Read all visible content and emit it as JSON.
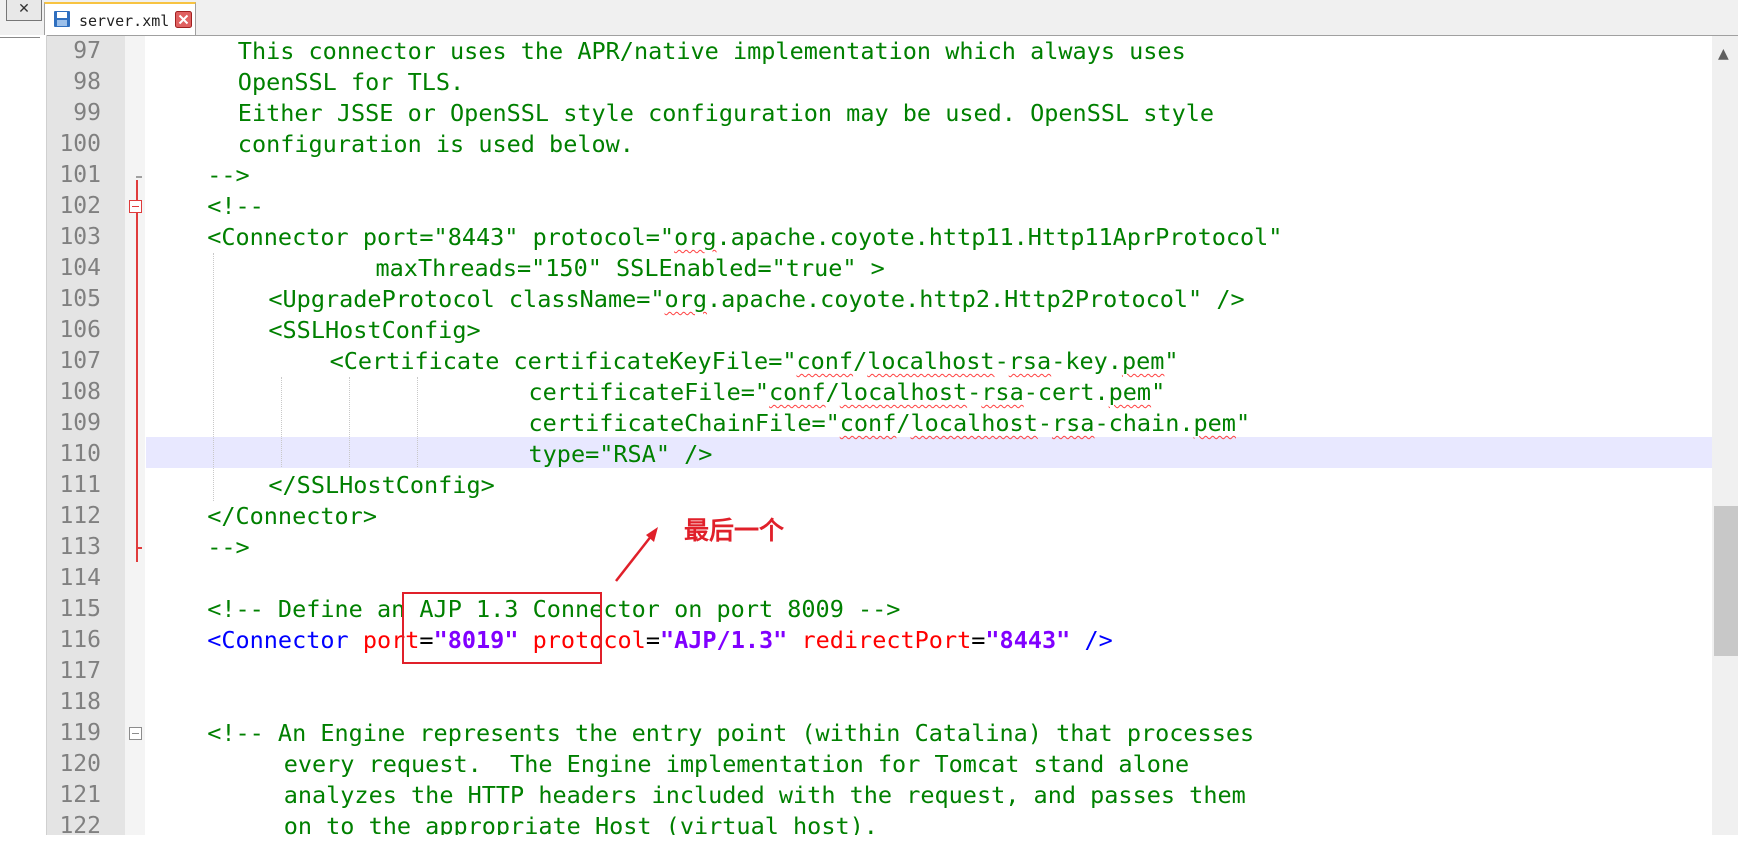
{
  "tab": {
    "close_all_glyph": "✕",
    "filename": "server.xml"
  },
  "annotation": {
    "label": "最后一个",
    "color": "#e0202a"
  },
  "editor": {
    "current_line": 110,
    "lines": [
      {
        "n": "97",
        "indent": 6,
        "segs": [
          {
            "c": "cm",
            "t": "This connector uses the APR/native implementation which always uses"
          }
        ]
      },
      {
        "n": "98",
        "indent": 6,
        "segs": [
          {
            "c": "cm",
            "t": "OpenSSL for TLS."
          }
        ]
      },
      {
        "n": "99",
        "indent": 6,
        "segs": [
          {
            "c": "cm",
            "t": "Either JSSE or OpenSSL style configuration may be used. OpenSSL style"
          }
        ]
      },
      {
        "n": "100",
        "indent": 6,
        "segs": [
          {
            "c": "cm",
            "t": "configuration is used below."
          }
        ]
      },
      {
        "n": "101",
        "indent": 4,
        "segs": [
          {
            "c": "cm",
            "t": "-->"
          }
        ]
      },
      {
        "n": "102",
        "indent": 4,
        "segs": [
          {
            "c": "cm",
            "t": "<!--"
          }
        ]
      },
      {
        "n": "103",
        "indent": 4,
        "segs": [
          {
            "c": "cm",
            "t": "<Connector port=\"8443\" protocol=\""
          },
          {
            "c": "cm sq",
            "t": "org"
          },
          {
            "c": "cm",
            "t": ".apache.coyote.http11.Http11AprProtocol\""
          }
        ]
      },
      {
        "n": "104",
        "indent": 15,
        "segs": [
          {
            "c": "cm",
            "t": "maxThreads=\"150\" SSLEnabled=\"true\" >"
          }
        ]
      },
      {
        "n": "105",
        "indent": 8,
        "segs": [
          {
            "c": "cm",
            "t": "<UpgradeProtocol className=\""
          },
          {
            "c": "cm sq",
            "t": "org"
          },
          {
            "c": "cm",
            "t": ".apache.coyote.http2.Http2Protocol\" />"
          }
        ]
      },
      {
        "n": "106",
        "indent": 8,
        "segs": [
          {
            "c": "cm",
            "t": "<SSLHostConfig>"
          }
        ]
      },
      {
        "n": "107",
        "indent": 12,
        "segs": [
          {
            "c": "cm",
            "t": "<Certificate certificateKeyFile=\""
          },
          {
            "c": "cm sq",
            "t": "conf"
          },
          {
            "c": "cm",
            "t": "/"
          },
          {
            "c": "cm sq",
            "t": "localhost"
          },
          {
            "c": "cm",
            "t": "-"
          },
          {
            "c": "cm sq",
            "t": "rsa"
          },
          {
            "c": "cm",
            "t": "-key."
          },
          {
            "c": "cm sq",
            "t": "pem"
          },
          {
            "c": "cm",
            "t": "\""
          }
        ]
      },
      {
        "n": "108",
        "indent": 25,
        "segs": [
          {
            "c": "cm",
            "t": "certificateFile=\""
          },
          {
            "c": "cm sq",
            "t": "conf"
          },
          {
            "c": "cm",
            "t": "/"
          },
          {
            "c": "cm sq",
            "t": "localhost"
          },
          {
            "c": "cm",
            "t": "-"
          },
          {
            "c": "cm sq",
            "t": "rsa"
          },
          {
            "c": "cm",
            "t": "-cert."
          },
          {
            "c": "cm sq",
            "t": "pem"
          },
          {
            "c": "cm",
            "t": "\""
          }
        ]
      },
      {
        "n": "109",
        "indent": 25,
        "segs": [
          {
            "c": "cm",
            "t": "certificateChainFile=\""
          },
          {
            "c": "cm sq",
            "t": "conf"
          },
          {
            "c": "cm",
            "t": "/"
          },
          {
            "c": "cm sq",
            "t": "localhost"
          },
          {
            "c": "cm",
            "t": "-"
          },
          {
            "c": "cm sq",
            "t": "rsa"
          },
          {
            "c": "cm",
            "t": "-chain."
          },
          {
            "c": "cm sq",
            "t": "pem"
          },
          {
            "c": "cm",
            "t": "\""
          }
        ]
      },
      {
        "n": "110",
        "indent": 25,
        "segs": [
          {
            "c": "cm",
            "t": "type=\"RSA\" />"
          }
        ]
      },
      {
        "n": "111",
        "indent": 8,
        "segs": [
          {
            "c": "cm",
            "t": "</SSLHostConfig>"
          }
        ]
      },
      {
        "n": "112",
        "indent": 4,
        "segs": [
          {
            "c": "cm",
            "t": "</Connector>"
          }
        ]
      },
      {
        "n": "113",
        "indent": 4,
        "segs": [
          {
            "c": "cm",
            "t": "-->"
          }
        ]
      },
      {
        "n": "114",
        "indent": 0,
        "segs": []
      },
      {
        "n": "115",
        "indent": 4,
        "segs": [
          {
            "c": "cm",
            "t": "<!-- Define an AJP 1.3 Connector on port 8009 -->"
          }
        ]
      },
      {
        "n": "116",
        "indent": 4,
        "segs": [
          {
            "c": "tg",
            "t": "<Connector "
          },
          {
            "c": "at",
            "t": "port"
          },
          {
            "c": "pl",
            "t": "="
          },
          {
            "c": "vl",
            "t": "\"8019\""
          },
          {
            "c": "pl",
            "t": " "
          },
          {
            "c": "at",
            "t": "protocol"
          },
          {
            "c": "pl",
            "t": "="
          },
          {
            "c": "vl",
            "t": "\"AJP/1.3\""
          },
          {
            "c": "pl",
            "t": " "
          },
          {
            "c": "at",
            "t": "redirectPort"
          },
          {
            "c": "pl",
            "t": "="
          },
          {
            "c": "vl",
            "t": "\"8443\""
          },
          {
            "c": "pl",
            "t": " "
          },
          {
            "c": "tg",
            "t": "/>"
          }
        ]
      },
      {
        "n": "117",
        "indent": 0,
        "segs": []
      },
      {
        "n": "118",
        "indent": 0,
        "segs": []
      },
      {
        "n": "119",
        "indent": 4,
        "segs": [
          {
            "c": "cm",
            "t": "<!-- An Engine represents the entry point (within Catalina) that processes"
          }
        ]
      },
      {
        "n": "120",
        "indent": 9,
        "segs": [
          {
            "c": "cm",
            "t": "every request.  The Engine implementation for Tomcat stand alone"
          }
        ]
      },
      {
        "n": "121",
        "indent": 9,
        "segs": [
          {
            "c": "cm",
            "t": "analyzes the HTTP headers included with the request, and passes them"
          }
        ]
      },
      {
        "n": "122",
        "indent": 9,
        "segs": [
          {
            "c": "cm",
            "t": "on to the appropriate Host (virtual host)."
          }
        ]
      }
    ]
  }
}
